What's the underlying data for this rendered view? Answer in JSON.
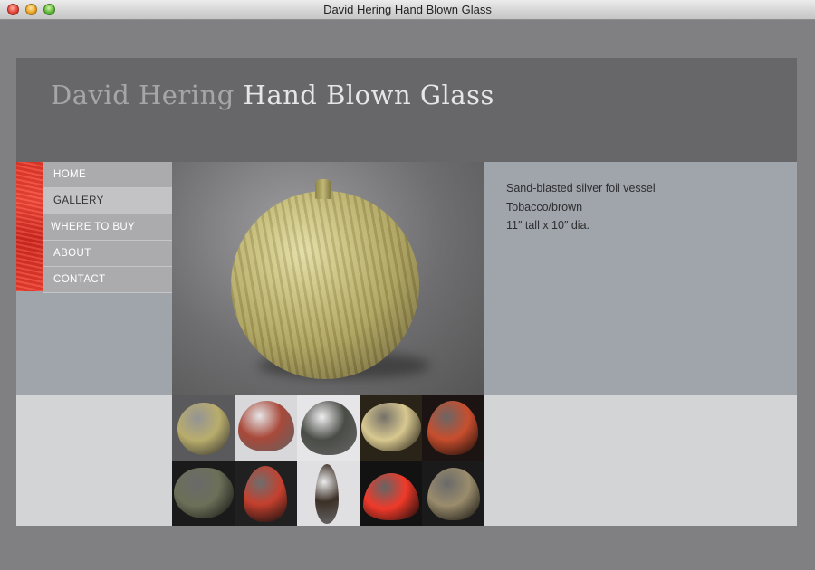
{
  "window": {
    "title": "David Hering Hand Blown Glass"
  },
  "header": {
    "title_part1": "David Hering",
    "title_part2": "Hand Blown Glass"
  },
  "nav": {
    "items": [
      {
        "label": "HOME",
        "active": false
      },
      {
        "label": "GALLERY",
        "active": true
      },
      {
        "label": "WHERE TO BUY",
        "active": false
      },
      {
        "label": "ABOUT",
        "active": false
      },
      {
        "label": "CONTACT",
        "active": false
      }
    ]
  },
  "main_image": {
    "icon": "round-gold-vessel-photo"
  },
  "description": {
    "line1": "Sand-blasted silver foil vessel",
    "line2": "Tobacco/brown",
    "line3": "11″ tall x 10″ dia."
  },
  "thumbnails": [
    {
      "icon": "gold-round-vessel-thumbnail",
      "bg": "#5a5a5c",
      "color": "#b9ad6c"
    },
    {
      "icon": "red-onion-vessel-thumbnail",
      "bg": "#d8d8da",
      "color": "#a8493a"
    },
    {
      "icon": "ribbed-black-vessel-thumbnail",
      "bg": "#e6e6e8",
      "color": "#4a4c46"
    },
    {
      "icon": "cream-round-vessel-thumbnail",
      "bg": "#2a2418",
      "color": "#d8c890"
    },
    {
      "icon": "orange-speckled-vessel-thumbnail",
      "bg": "#1c1412",
      "color": "#c84e2e"
    },
    {
      "icon": "green-speckled-vessel-thumbnail",
      "bg": "#1a1a1a",
      "color": "#6c7058"
    },
    {
      "icon": "red-teardrop-vessel-thumbnail",
      "bg": "#202020",
      "color": "#c5402e"
    },
    {
      "icon": "tall-mosaic-vessel-thumbnail",
      "bg": "#e0e0e2",
      "color": "#3c3026"
    },
    {
      "icon": "bright-red-vessel-thumbnail",
      "bg": "#121212",
      "color": "#f03a2a"
    },
    {
      "icon": "speckled-tan-vessel-thumbnail",
      "bg": "#1a1a1a",
      "color": "#9a8c6c"
    }
  ]
}
